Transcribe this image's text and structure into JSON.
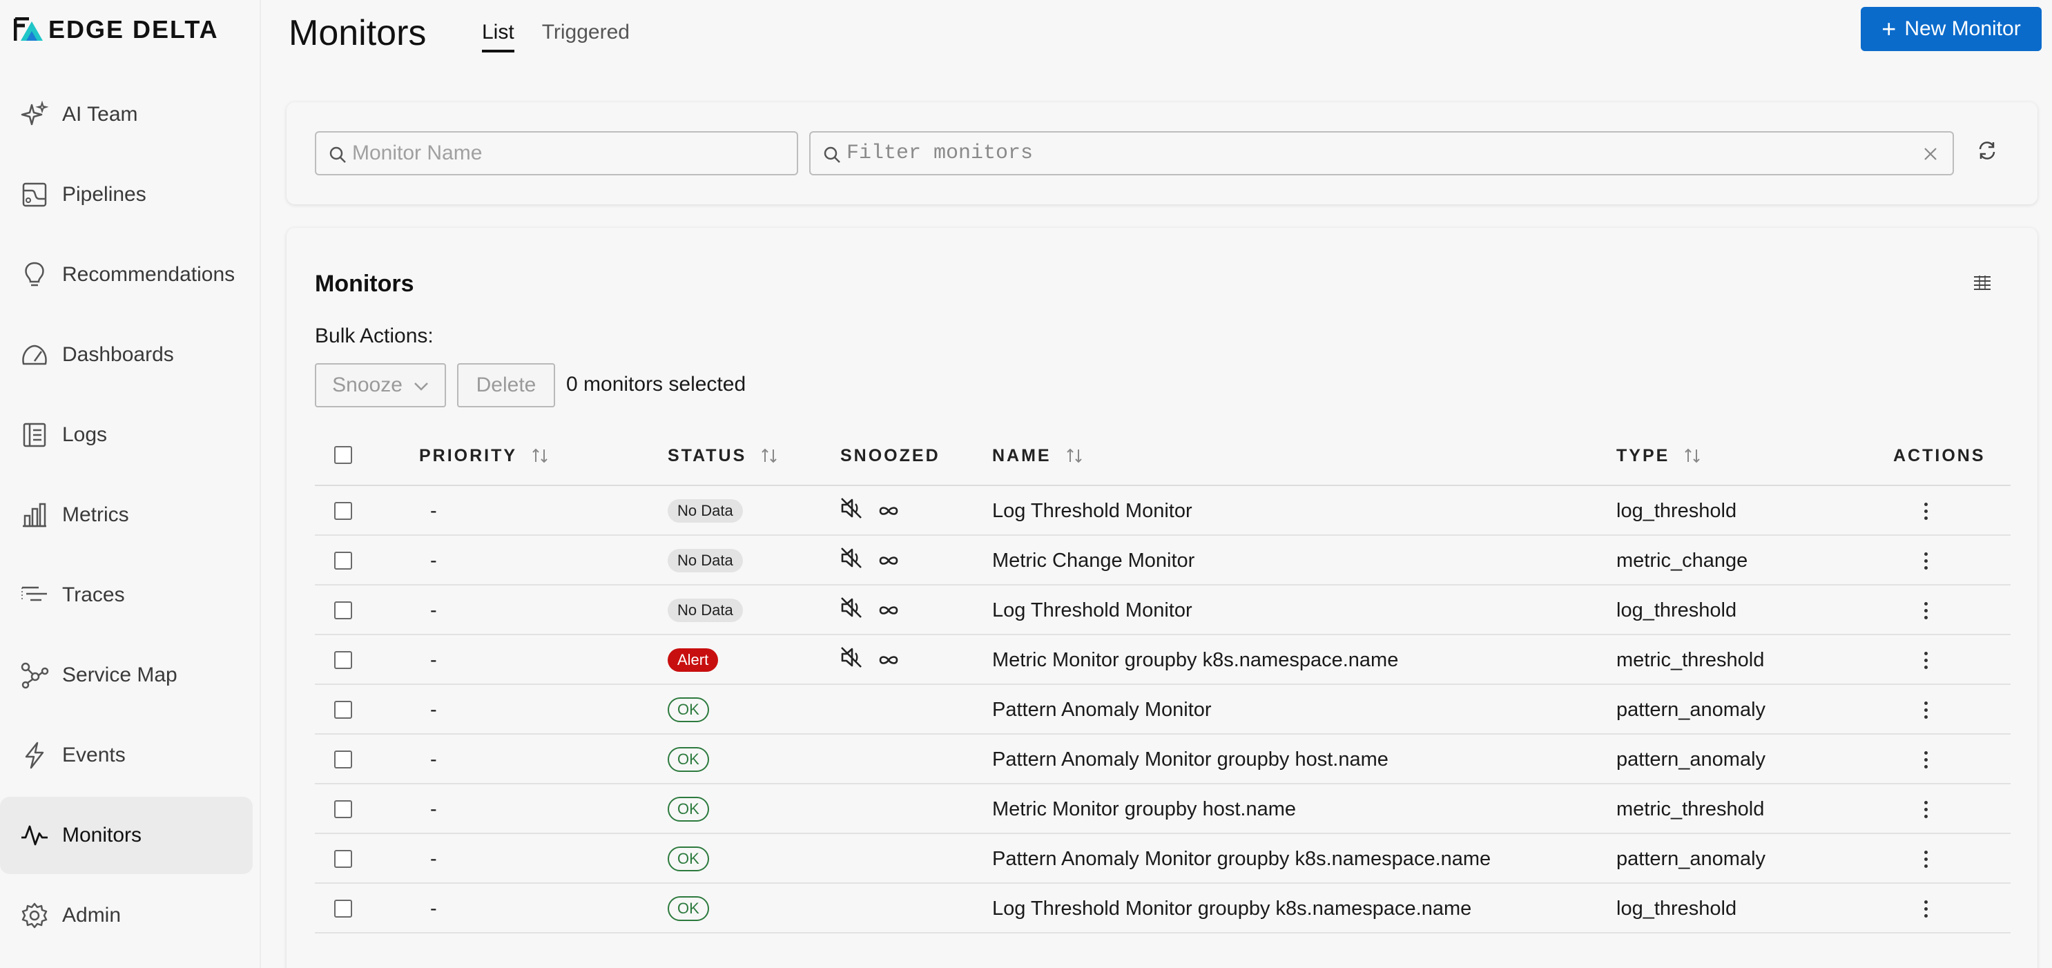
{
  "brand": {
    "name": "EDGE DELTA",
    "accent": "#0b6bcb"
  },
  "sidebar": {
    "items": [
      {
        "label": "AI Team",
        "icon": "sparkles-icon",
        "active": false
      },
      {
        "label": "Pipelines",
        "icon": "pipelines-icon",
        "active": false
      },
      {
        "label": "Recommendations",
        "icon": "lightbulb-icon",
        "active": false
      },
      {
        "label": "Dashboards",
        "icon": "gauge-icon",
        "active": false
      },
      {
        "label": "Logs",
        "icon": "logs-icon",
        "active": false
      },
      {
        "label": "Metrics",
        "icon": "bar-chart-icon",
        "active": false
      },
      {
        "label": "Traces",
        "icon": "traces-icon",
        "active": false
      },
      {
        "label": "Service Map",
        "icon": "service-map-icon",
        "active": false
      },
      {
        "label": "Events",
        "icon": "lightning-icon",
        "active": false
      },
      {
        "label": "Monitors",
        "icon": "pulse-icon",
        "active": true
      },
      {
        "label": "Admin",
        "icon": "gear-icon",
        "active": false
      }
    ]
  },
  "header": {
    "title": "Monitors",
    "tabs": [
      {
        "label": "List",
        "active": true
      },
      {
        "label": "Triggered",
        "active": false
      }
    ],
    "new_button": "New Monitor"
  },
  "filters": {
    "name_placeholder": "Monitor Name",
    "filter_placeholder": "Filter monitors"
  },
  "table": {
    "title": "Monitors",
    "bulk_label": "Bulk Actions:",
    "snooze_label": "Snooze",
    "delete_label": "Delete",
    "selected_count": "0 monitors selected",
    "columns": [
      "PRIORITY",
      "STATUS",
      "SNOOZED",
      "NAME",
      "TYPE",
      "ACTIONS"
    ],
    "rows": [
      {
        "priority": "-",
        "status": "No Data",
        "snoozed": true,
        "name": "Log Threshold Monitor",
        "type": "log_threshold"
      },
      {
        "priority": "-",
        "status": "No Data",
        "snoozed": true,
        "name": "Metric Change Monitor",
        "type": "metric_change"
      },
      {
        "priority": "-",
        "status": "No Data",
        "snoozed": true,
        "name": "Log Threshold Monitor",
        "type": "log_threshold"
      },
      {
        "priority": "-",
        "status": "Alert",
        "snoozed": true,
        "name": "Metric Monitor groupby k8s.namespace.name",
        "type": "metric_threshold"
      },
      {
        "priority": "-",
        "status": "OK",
        "snoozed": false,
        "name": "Pattern Anomaly Monitor",
        "type": "pattern_anomaly"
      },
      {
        "priority": "-",
        "status": "OK",
        "snoozed": false,
        "name": "Pattern Anomaly Monitor groupby host.name",
        "type": "pattern_anomaly"
      },
      {
        "priority": "-",
        "status": "OK",
        "snoozed": false,
        "name": "Metric Monitor groupby host.name",
        "type": "metric_threshold"
      },
      {
        "priority": "-",
        "status": "OK",
        "snoozed": false,
        "name": "Pattern Anomaly Monitor groupby k8s.namespace.name",
        "type": "pattern_anomaly"
      },
      {
        "priority": "-",
        "status": "OK",
        "snoozed": false,
        "name": "Log Threshold Monitor groupby k8s.namespace.name",
        "type": "log_threshold"
      }
    ]
  },
  "status_colors": {
    "alert": "#c80f0f",
    "ok": "#2d7a3e",
    "nodata": "#e3e3e3"
  }
}
